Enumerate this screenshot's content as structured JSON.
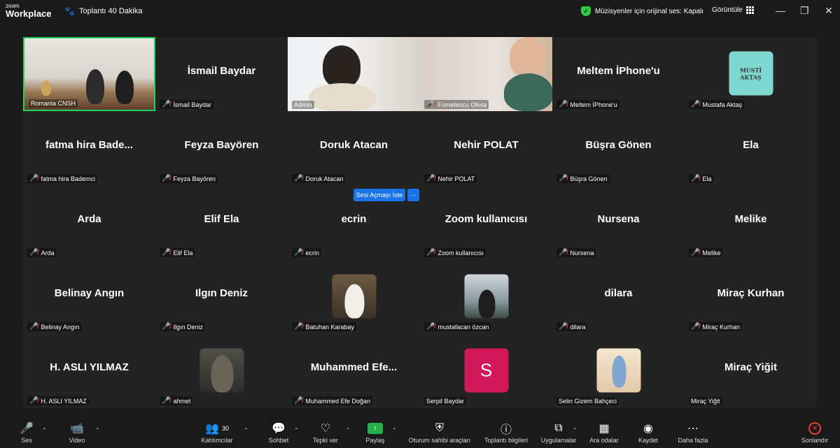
{
  "app": {
    "logo_line1": "zoom",
    "logo_line2": "Workplace",
    "meeting_title": "Toplantı 40 Dakika"
  },
  "header": {
    "original_sound": "Müzisyenler için orijinal ses: Kapalı",
    "view_label": "Görüntüle"
  },
  "gallery": {
    "tiles": [
      {
        "name": "Romania CNSH",
        "big": ""
      },
      {
        "name": "İsmail Baydar",
        "big": "İsmail Baydar"
      },
      {
        "name": "Admin",
        "big": ""
      },
      {
        "name": "Fometescu Olivia",
        "big": ""
      },
      {
        "name": "Meltem İPhone'u",
        "big": "Meltem İPhone'u"
      },
      {
        "name": "Mustafa Aktaş",
        "big": ""
      },
      {
        "name": "fatma hira Bademci",
        "big": "fatma hira Bade..."
      },
      {
        "name": "Feyza Bayören",
        "big": "Feyza Bayören"
      },
      {
        "name": "Doruk Atacan",
        "big": "Doruk Atacan"
      },
      {
        "name": "Nehir POLAT",
        "big": "Nehir POLAT"
      },
      {
        "name": "Büşra Gönen",
        "big": "Büşra Gönen"
      },
      {
        "name": "Ela",
        "big": "Ela"
      },
      {
        "name": "Arda",
        "big": "Arda"
      },
      {
        "name": "Elif Ela",
        "big": "Elif Ela"
      },
      {
        "name": "ecrin",
        "big": "ecrin"
      },
      {
        "name": "Zoom kullanıcısı",
        "big": "Zoom kullanıcısı"
      },
      {
        "name": "Nursena",
        "big": "Nursena"
      },
      {
        "name": "Melike",
        "big": "Melike"
      },
      {
        "name": "Belinay Angın",
        "big": "Belinay Angın"
      },
      {
        "name": "Ilgın Deniz",
        "big": "Ilgın Deniz"
      },
      {
        "name": "Batuhan Karabay",
        "big": ""
      },
      {
        "name": "mustafacan özcan",
        "big": ""
      },
      {
        "name": "dilara",
        "big": "dilara"
      },
      {
        "name": "Miraç Kurhan",
        "big": "Miraç Kurhan"
      },
      {
        "name": "H. ASLI YILMAZ",
        "big": "H. ASLI YILMAZ"
      },
      {
        "name": "ahmet",
        "big": ""
      },
      {
        "name": "Muhammed Efe Doğan",
        "big": "Muhammed  Efe..."
      },
      {
        "name": "Serpil Baydar",
        "big": ""
      },
      {
        "name": "Selin Gizem Bahçeci",
        "big": ""
      },
      {
        "name": "Miraç Yiğit",
        "big": "Miraç Yiğit"
      }
    ],
    "avatar_musti_l1": "MUSTİ",
    "avatar_musti_l2": "AKTAŞ",
    "avatar_s_letter": "S",
    "ask_unmute": "Sesi Açmayı İste",
    "more_dots": "···"
  },
  "toolbar": {
    "audio": "Ses",
    "video": "Video",
    "participants": "Katılımcılar",
    "participants_count": "30",
    "chat": "Sohbet",
    "reactions": "Tepki ver",
    "share": "Paylaş",
    "host_tools": "Oturum sahibi araçları",
    "meeting_info": "Toplantı bilgileri",
    "apps": "Uygulamalar",
    "rooms": "Ara odalar",
    "record": "Kaydet",
    "more": "Daha fazla",
    "end": "Sonlandır"
  },
  "colors": {
    "accent": "#23d160",
    "muted": "#e8413a",
    "share": "#23b14d",
    "button_blue": "#1a73e8",
    "avatar_s": "#d11858"
  }
}
